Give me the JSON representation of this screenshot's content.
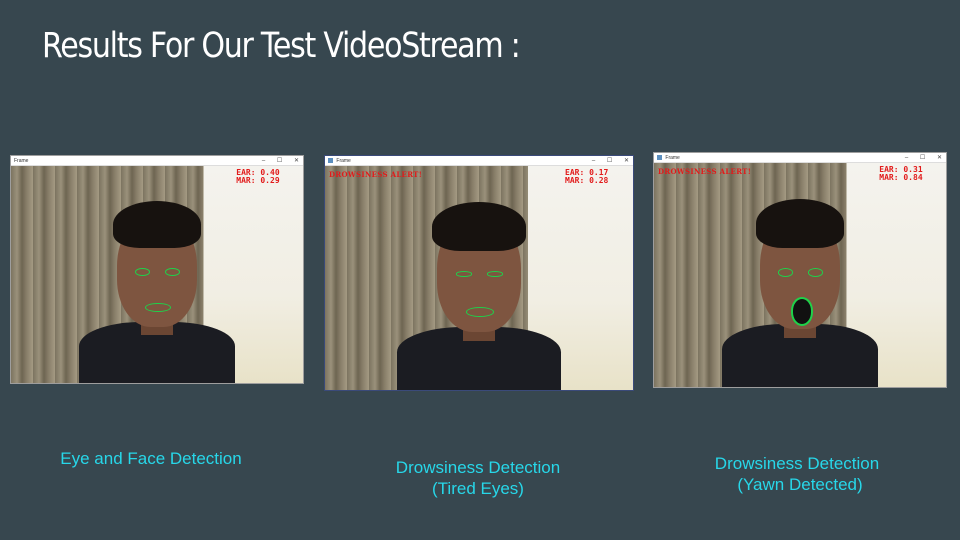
{
  "slide": {
    "title": "Results For Our Test VideoStream :"
  },
  "windows": [
    {
      "window_title": "Frame",
      "ear_text": "EAR: 0.40",
      "mar_text": "MAR: 0.29",
      "alert_text": "",
      "caption_line1": "Eye and Face Detection",
      "caption_line2": ""
    },
    {
      "window_title": "Frame",
      "ear_text": "EAR: 0.17",
      "mar_text": "MAR: 0.28",
      "alert_text": "DROWSINESS ALERT!",
      "caption_line1": "Drowsiness Detection",
      "caption_line2": "(Tired Eyes)"
    },
    {
      "window_title": "Frame",
      "ear_text": "EAR: 0.31",
      "mar_text": "MAR: 0.84",
      "alert_text": "DROWSINESS ALERT!",
      "caption_line1": "Drowsiness Detection",
      "caption_line2": "(Yawn Detected)"
    }
  ],
  "window_controls": [
    "–",
    "☐",
    "✕"
  ],
  "colors": {
    "background": "#37474f",
    "title_text": "#ffffff",
    "caption_text": "#27d7e9",
    "overlay_text": "#e21b1b",
    "landmark_outline": "#1fd14a"
  }
}
